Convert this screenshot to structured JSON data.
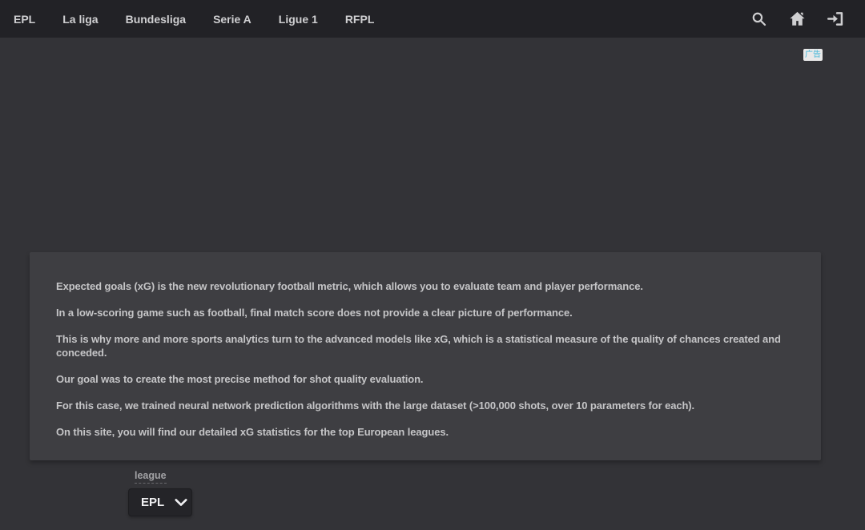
{
  "nav": {
    "items": [
      {
        "label": "EPL"
      },
      {
        "label": "La liga"
      },
      {
        "label": "Bundesliga"
      },
      {
        "label": "Serie A"
      },
      {
        "label": "Ligue 1"
      },
      {
        "label": "RFPL"
      }
    ],
    "icons": [
      {
        "name": "search-icon"
      },
      {
        "name": "home-icon"
      },
      {
        "name": "sign-in-icon"
      }
    ]
  },
  "ad_badge": {
    "label": "广告"
  },
  "intro_panel": {
    "paragraphs": [
      "Expected goals (xG) is the new revolutionary football metric, which allows you to evaluate team and player performance.",
      "In a low-scoring game such as football, final match score does not provide a clear picture of performance.",
      "This is why more and more sports analytics turn to the advanced models like xG, which is a statistical measure of the quality of chances created and conceded.",
      "Our goal was to create the most precise method for shot quality evaluation.",
      "For this case, we trained neural network prediction algorithms with the large dataset (>100,000 shots, over 10 parameters for each).",
      "On this site, you will find our detailed xG statistics for the top European leagues."
    ]
  },
  "league_filter": {
    "label": "league",
    "selected": "EPL"
  },
  "colors": {
    "header_bg": "#222226",
    "page_bg": "#333337",
    "panel_bg": "#3e3e42",
    "body_text": "#c5c5c7",
    "nav_text": "#cfcfd1",
    "select_bg": "#242428",
    "ad_badge_text": "#3db5d8"
  }
}
